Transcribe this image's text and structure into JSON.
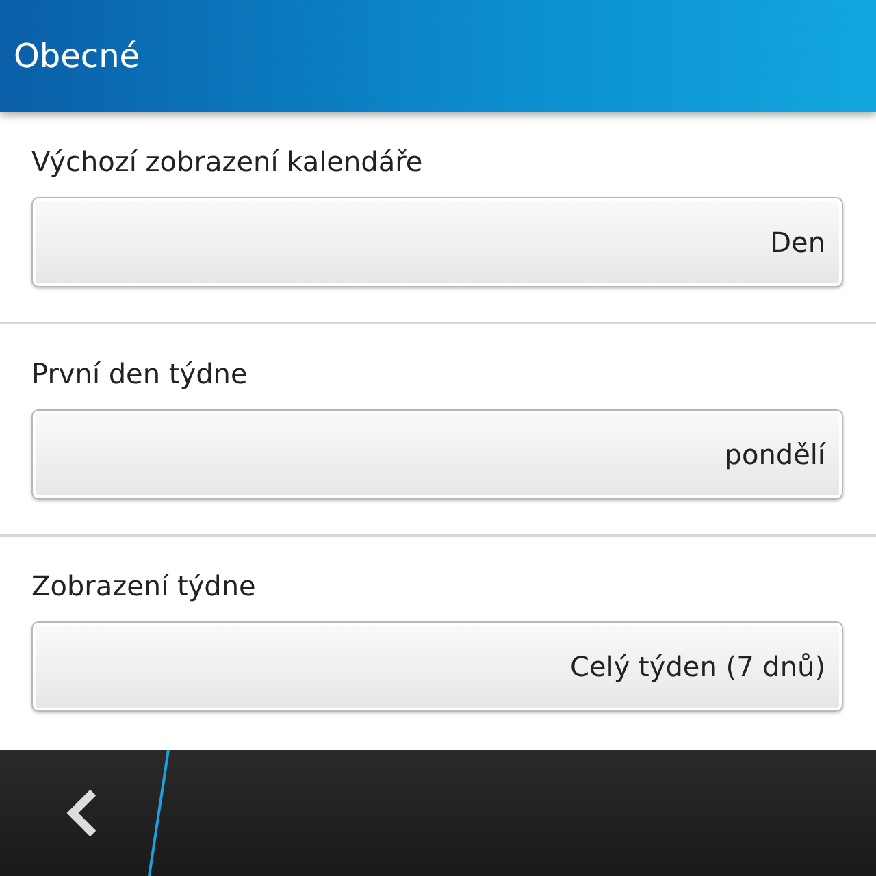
{
  "header": {
    "title": "Obecné"
  },
  "settings": [
    {
      "label": "Výchozí zobrazení kalendáře",
      "value": "Den"
    },
    {
      "label": "První den týdne",
      "value": "pondělí"
    },
    {
      "label": "Zobrazení týdne",
      "value": "Celý týden (7 dnů)"
    }
  ]
}
